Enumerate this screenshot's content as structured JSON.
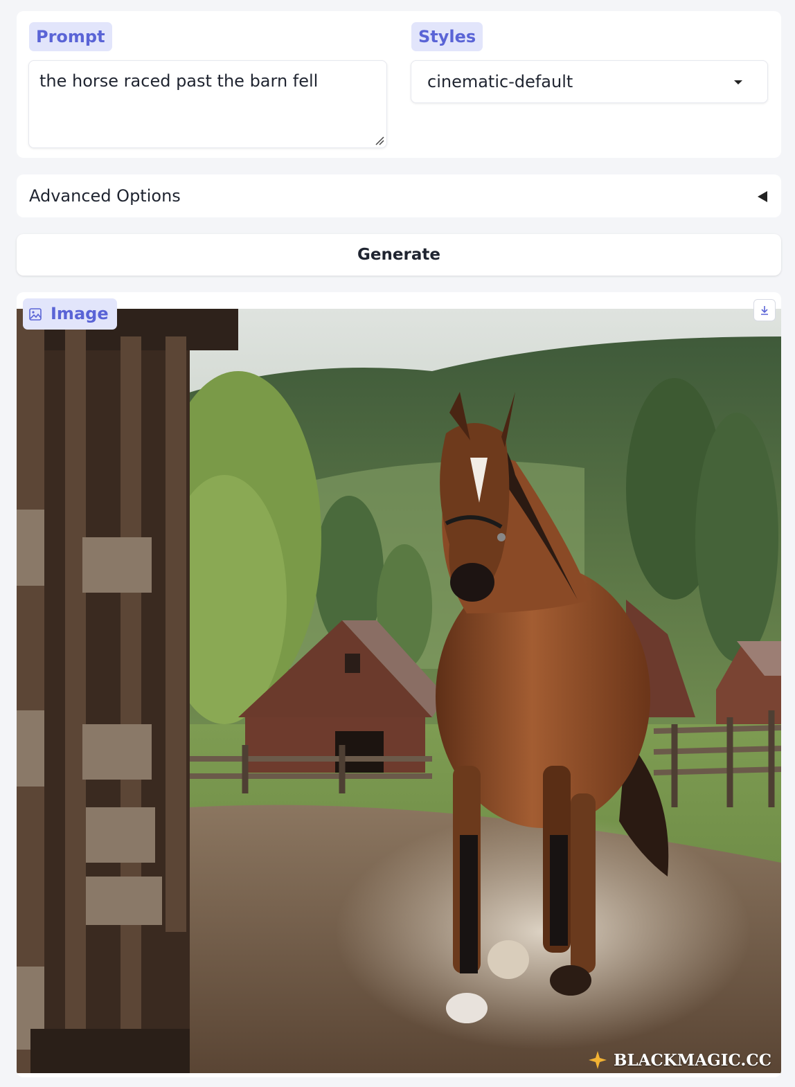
{
  "prompt": {
    "label": "Prompt",
    "value": "the horse raced past the barn fell"
  },
  "styles": {
    "label": "Styles",
    "selected": "cinematic-default"
  },
  "advanced": {
    "title": "Advanced Options"
  },
  "generate": {
    "label": "Generate"
  },
  "output": {
    "label": "Image",
    "watermark": "BLACKMAGIC.CC"
  },
  "colors": {
    "accent": "#5a64d6",
    "chip_bg": "#e2e5fb",
    "page_bg": "#f4f5f8"
  }
}
